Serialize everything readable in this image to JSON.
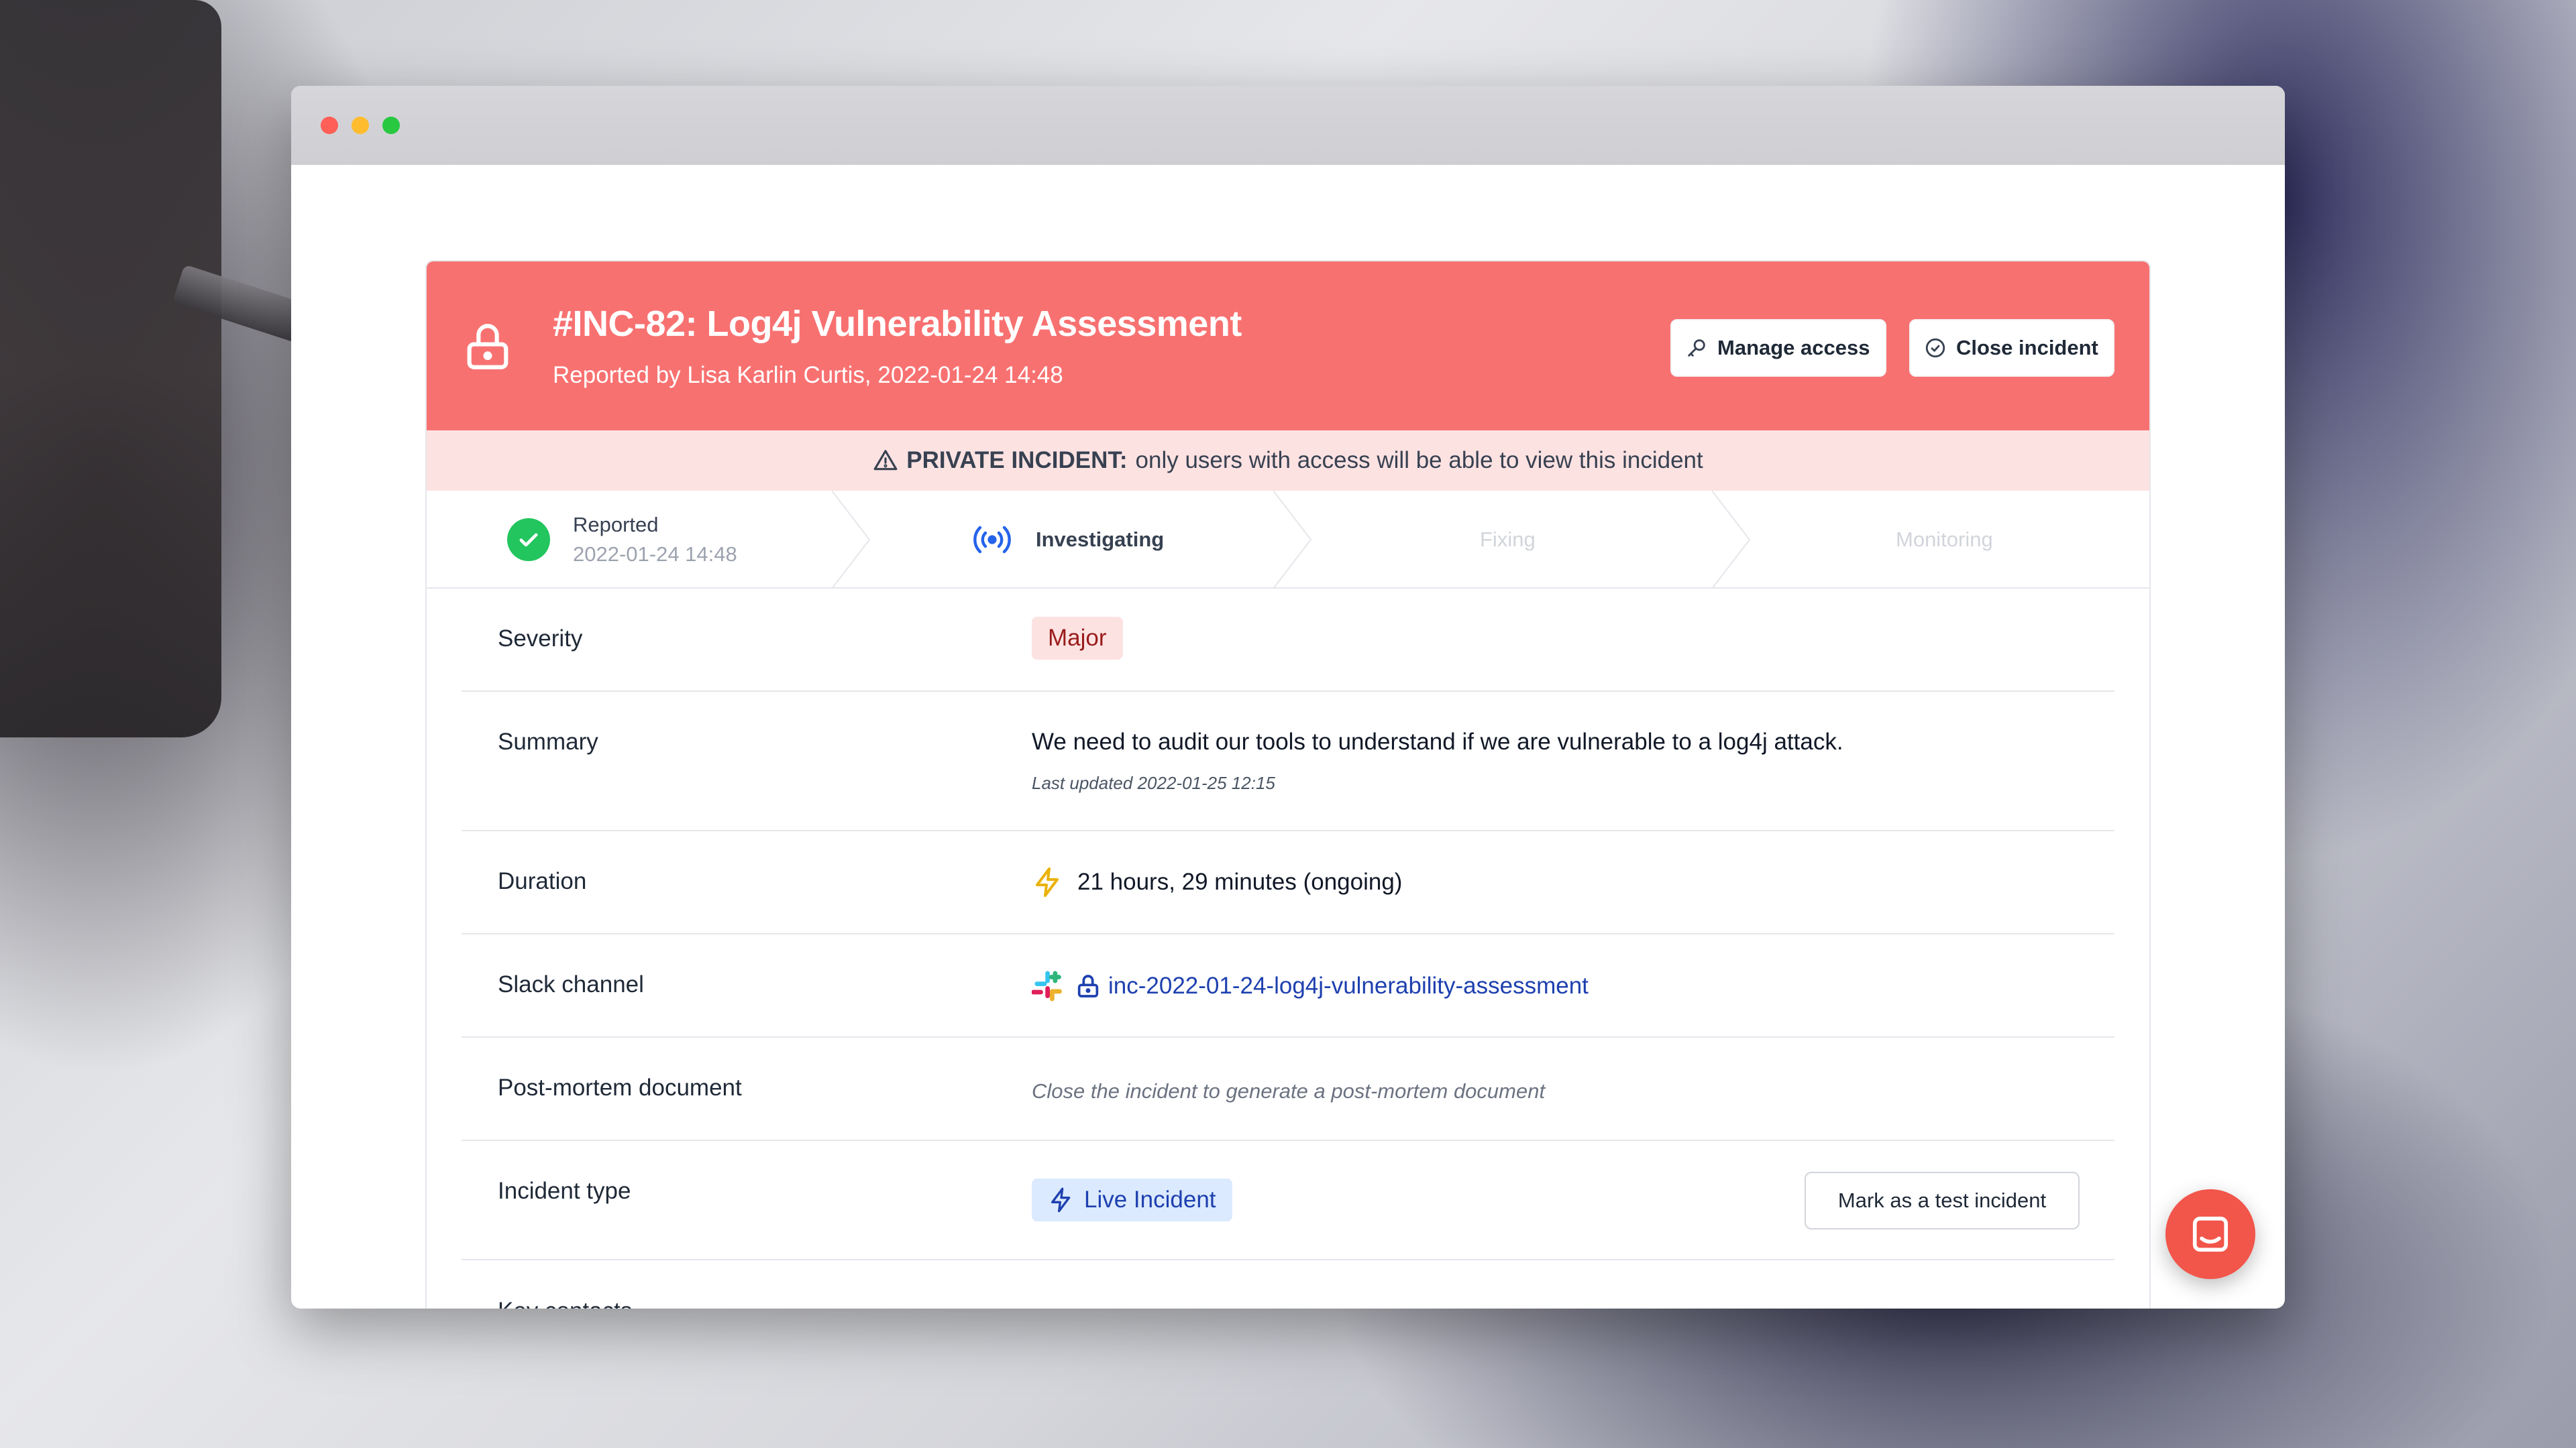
{
  "incident": {
    "title": "#INC-82: Log4j Vulnerability Assessment",
    "reported_by": "Reported by Lisa Karlin Curtis, 2022-01-24 14:48",
    "manage_access_label": "Manage access",
    "close_incident_label": "Close incident"
  },
  "banner": {
    "strong": "PRIVATE INCIDENT:",
    "text": "only users with access will be able to view this incident"
  },
  "stepper": {
    "reported_label": "Reported",
    "reported_time": "2022-01-24 14:48",
    "investigating_label": "Investigating",
    "fixing_label": "Fixing",
    "monitoring_label": "Monitoring"
  },
  "fields": {
    "severity_label": "Severity",
    "severity_value": "Major",
    "summary_label": "Summary",
    "summary_value": "We need to audit our tools to understand if we are vulnerable to a log4j attack.",
    "summary_updated": "Last updated 2022-01-25 12:15",
    "duration_label": "Duration",
    "duration_value": "21 hours, 29 minutes (ongoing)",
    "slack_label": "Slack channel",
    "slack_value": "inc-2022-01-24-log4j-vulnerability-assessment",
    "postmortem_label": "Post-mortem document",
    "postmortem_value": "Close the incident to generate a post-mortem document",
    "type_label": "Incident type",
    "type_value": "Live Incident",
    "test_button": "Mark as a test incident",
    "key_contacts_label": "Key contacts"
  },
  "colors": {
    "header_red": "#f87171",
    "banner_pink": "#fde2e2",
    "success_green": "#22c55e",
    "link_blue": "#1e40af",
    "chat_red": "#f2554a"
  },
  "icons": [
    "lock-icon",
    "key-icon",
    "check-circle-icon",
    "warning-icon",
    "check-icon",
    "broadcast-icon",
    "lightning-icon",
    "slack-icon",
    "chat-icon"
  ]
}
